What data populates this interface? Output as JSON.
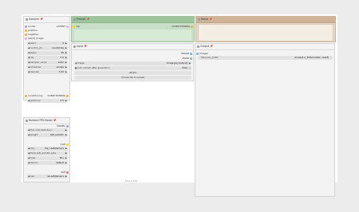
{
  "sampler": {
    "title": "Sampler",
    "inputs": [
      "model",
      "positive",
      "negative",
      "latent_image"
    ],
    "output": "LATENT",
    "widgets": [
      {
        "label": "seed",
        "value": "0"
      },
      {
        "label": "control_af...",
        "value": "randomize"
      },
      {
        "label": "steps",
        "value": "20"
      },
      {
        "label": "cfg",
        "value": "7.0"
      },
      {
        "label": "sampler_name",
        "value": "euler"
      },
      {
        "label": "scheduler",
        "value": "simple"
      },
      {
        "label": "denoise",
        "value": "1.00"
      }
    ],
    "conditioning_in": "conditioning",
    "conditioning_out": "CONDITIONING",
    "guidance": {
      "label": "guidance",
      "value": "2.5"
    }
  },
  "prompt": {
    "title": "Prompt",
    "input": "clip",
    "output": "CONDITIONING"
  },
  "notes": {
    "title": "Notes"
  },
  "input": {
    "title": "Input",
    "outputs": [
      "IMAGE",
      "MASK"
    ],
    "widgets": [
      {
        "label": "image",
        "value": "image.jpg [output]"
      },
      {
        "label": "auto refresh after generation",
        "value": "false"
      }
    ],
    "buttons": [
      "refresh",
      "choose file to upload"
    ]
  },
  "output": {
    "title": "Output",
    "input": "images",
    "widget": {
      "label": "filename_prefix",
      "value": "Kontext-1_ToilSomethin new/Fi"
    }
  },
  "kontext": {
    "title": "Kontext FP8 Model",
    "model_out": "MODEL",
    "model_widgets": [
      {
        "label": "flux-1-kontext-dev/...",
        "value": ""
      },
      {
        "label": "weight",
        "value": "fp8_e4m3fn"
      }
    ],
    "clip_out": "CLIP",
    "clip_widgets": [
      {
        "label": "clip_",
        "value": "clip_l.safetensors"
      },
      {
        "label": "t5xxl_fp8_e4m3fn.safe",
        "value": ""
      },
      {
        "label": "type",
        "value": "flux"
      },
      {
        "label": "device",
        "value": "default"
      }
    ],
    "vae_out": "VAE",
    "vae_widget": {
      "label": "vae",
      "value": "ae.safetensors"
    }
  },
  "canvas": {
    "size_caption": "512 x 512"
  },
  "colors": {
    "model": "#b39ddb",
    "conditioning": "#ffa931",
    "latent": "#ff9cf9",
    "image": "#64b5f6",
    "mask": "#81c784",
    "clip": "#ffd500",
    "vae": "#ff6e6e",
    "prompt_header": "#9ec49c",
    "notes_header": "#cfb49a"
  }
}
